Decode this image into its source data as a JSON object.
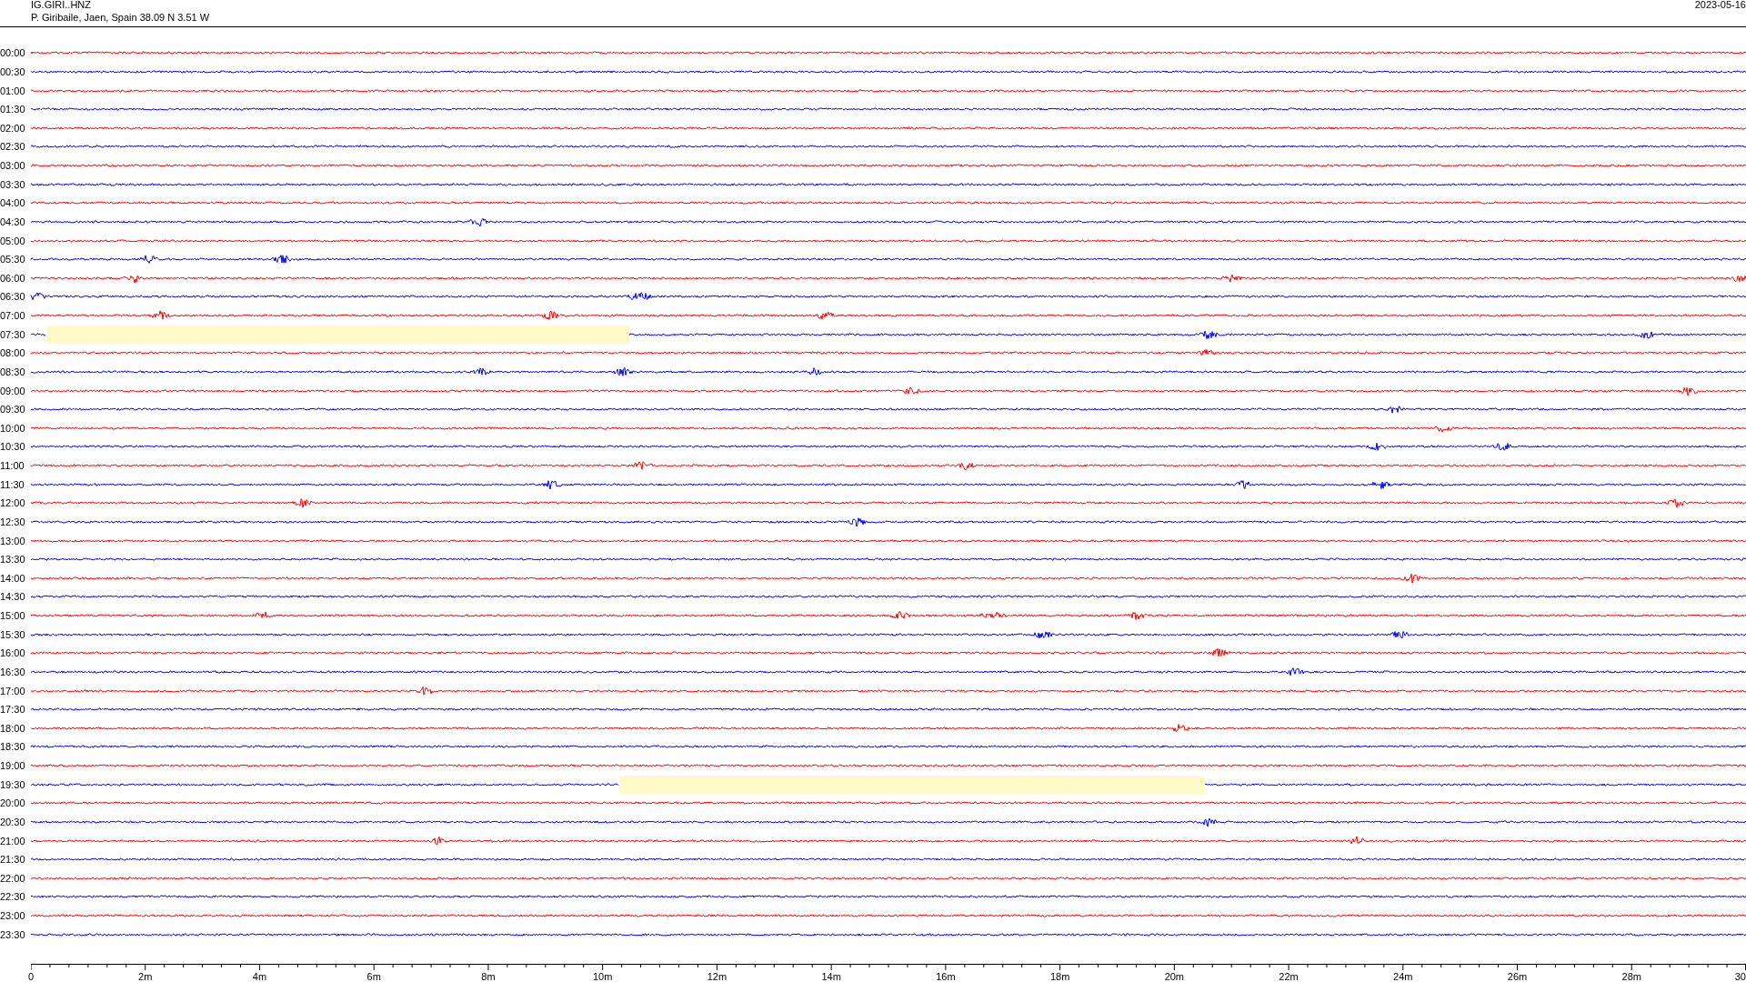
{
  "header": {
    "station": "IG.GIRI..HNZ",
    "location": "P. Giribaile, Jaen, Spain  38.09 N 3.51 W",
    "date": "2023-05-16"
  },
  "rows": [
    {
      "time": "00:00",
      "color": "#ff0000"
    },
    {
      "time": "00:30",
      "color": "#0000ff"
    },
    {
      "time": "01:00",
      "color": "#ff0000"
    },
    {
      "time": "01:30",
      "color": "#0000ff"
    },
    {
      "time": "02:00",
      "color": "#ff0000"
    },
    {
      "time": "02:30",
      "color": "#0000ff"
    },
    {
      "time": "03:00",
      "color": "#ff0000"
    },
    {
      "time": "03:30",
      "color": "#0000ff"
    },
    {
      "time": "04:00",
      "color": "#ff0000"
    },
    {
      "time": "04:30",
      "color": "#0000ff"
    },
    {
      "time": "05:00",
      "color": "#ff0000"
    },
    {
      "time": "05:30",
      "color": "#0000ff"
    },
    {
      "time": "06:00",
      "color": "#ff0000"
    },
    {
      "time": "06:30",
      "color": "#0000ff"
    },
    {
      "time": "07:00",
      "color": "#ff0000"
    },
    {
      "time": "07:30",
      "color": "#0000ff"
    },
    {
      "time": "08:00",
      "color": "#ff0000"
    },
    {
      "time": "08:30",
      "color": "#0000ff"
    },
    {
      "time": "09:00",
      "color": "#ff0000"
    },
    {
      "time": "09:30",
      "color": "#0000ff"
    },
    {
      "time": "10:00",
      "color": "#ff0000"
    },
    {
      "time": "10:30",
      "color": "#0000ff"
    },
    {
      "time": "11:00",
      "color": "#ff0000"
    },
    {
      "time": "11:30",
      "color": "#0000ff"
    },
    {
      "time": "12:00",
      "color": "#ff0000"
    },
    {
      "time": "12:30",
      "color": "#0000ff"
    },
    {
      "time": "13:00",
      "color": "#ff0000"
    },
    {
      "time": "13:30",
      "color": "#0000ff"
    },
    {
      "time": "14:00",
      "color": "#ff0000"
    },
    {
      "time": "14:30",
      "color": "#0000ff"
    },
    {
      "time": "15:00",
      "color": "#ff0000"
    },
    {
      "time": "15:30",
      "color": "#0000ff"
    },
    {
      "time": "16:00",
      "color": "#ff0000"
    },
    {
      "time": "16:30",
      "color": "#0000ff"
    },
    {
      "time": "17:00",
      "color": "#ff0000"
    },
    {
      "time": "17:30",
      "color": "#0000ff"
    },
    {
      "time": "18:00",
      "color": "#ff0000"
    },
    {
      "time": "18:30",
      "color": "#0000ff"
    },
    {
      "time": "19:00",
      "color": "#ff0000"
    },
    {
      "time": "19:30",
      "color": "#0000ff"
    },
    {
      "time": "20:00",
      "color": "#ff0000"
    },
    {
      "time": "20:30",
      "color": "#0000ff"
    },
    {
      "time": "21:00",
      "color": "#ff0000"
    },
    {
      "time": "21:30",
      "color": "#0000ff"
    },
    {
      "time": "22:00",
      "color": "#ff0000"
    },
    {
      "time": "22:30",
      "color": "#0000ff"
    },
    {
      "time": "23:00",
      "color": "#ff0000"
    },
    {
      "time": "23:30",
      "color": "#0000ff"
    }
  ],
  "axis": {
    "ticks": [
      "0",
      "2m",
      "4m",
      "6m",
      "8m",
      "10m",
      "12m",
      "14m",
      "16m",
      "18m",
      "20m",
      "22m",
      "24m",
      "26m",
      "28m",
      "30"
    ]
  }
}
